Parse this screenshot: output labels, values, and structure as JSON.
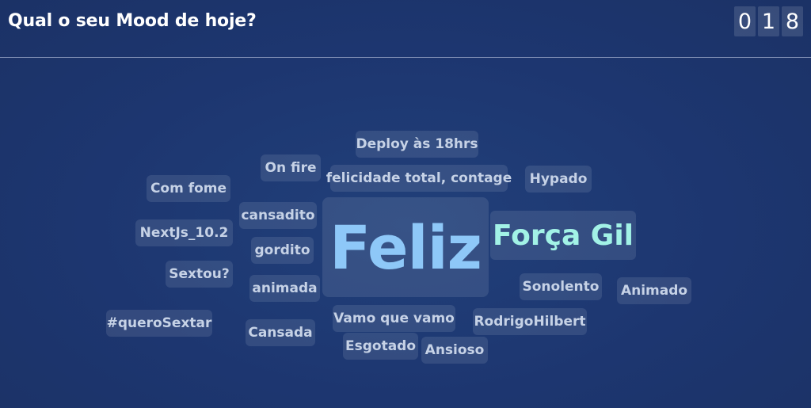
{
  "header": {
    "title": "Qual o seu Mood de hoje?",
    "counter_digits": [
      "0",
      "1",
      "8"
    ],
    "counter_value": 18
  },
  "colors": {
    "background": "#1d3670",
    "tag_text": "#c6d2e6",
    "top_word": "#8ec8f8",
    "second_word": "#a2f2e6",
    "divider": "#7e8db3"
  },
  "words": [
    {
      "text": "Feliz",
      "rank": 1
    },
    {
      "text": "Força Gil",
      "rank": 2
    },
    {
      "text": "Deploy às 18hrs",
      "rank": 3
    },
    {
      "text": "On fire",
      "rank": 3
    },
    {
      "text": "felicidade total, contage",
      "rank": 3
    },
    {
      "text": "Hypado",
      "rank": 3
    },
    {
      "text": "Com fome",
      "rank": 3
    },
    {
      "text": "cansadito",
      "rank": 3
    },
    {
      "text": "NextJs_10.2",
      "rank": 3
    },
    {
      "text": "gordito",
      "rank": 3
    },
    {
      "text": "Sextou?",
      "rank": 3
    },
    {
      "text": "animada",
      "rank": 3
    },
    {
      "text": "Sonolento",
      "rank": 3
    },
    {
      "text": "Animado",
      "rank": 3
    },
    {
      "text": "#queroSextar",
      "rank": 3
    },
    {
      "text": "Cansada",
      "rank": 3
    },
    {
      "text": "Vamo que vamo",
      "rank": 3
    },
    {
      "text": "RodrigoHilbert",
      "rank": 3
    },
    {
      "text": "Esgotado",
      "rank": 3
    },
    {
      "text": "Ansioso",
      "rank": 3
    }
  ]
}
